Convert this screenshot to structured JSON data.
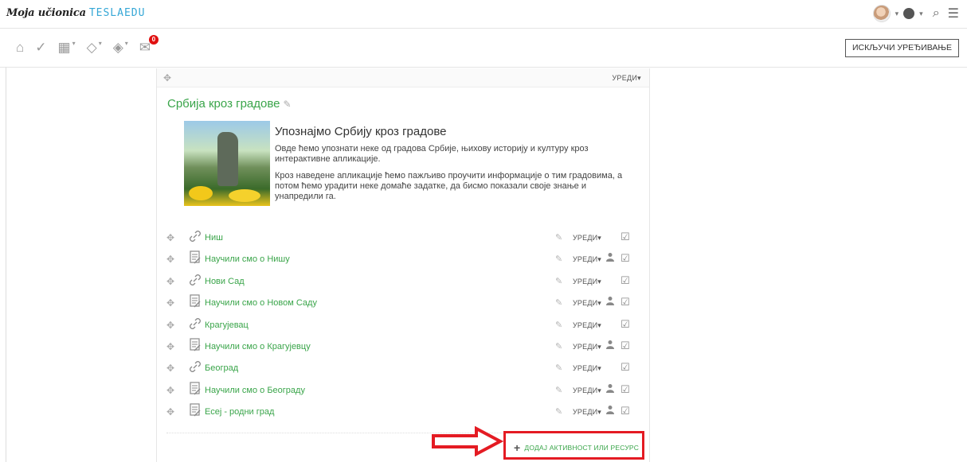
{
  "topbar": {
    "logo_script": "Moja učionica",
    "logo_brand": "TESLAEDU",
    "user_avatar": "avatar",
    "language_icon": "globe-icon",
    "search_icon": "search-icon",
    "menu_icon": "hamburger-icon"
  },
  "navbar": {
    "icons": [
      "home-icon",
      "checkmark-icon",
      "calendar-icon",
      "graduation-cap-icon",
      "graduation-cap-settings-icon",
      "messages-icon"
    ],
    "messages_badge": "0",
    "edit_mode_button": "ИСКЉУЧИ УРЕЂИВАЊЕ"
  },
  "section": {
    "edit_label": "УРЕДИ",
    "title": "Србија кроз градове",
    "summary_heading": "Упознајмо Србију кроз градове",
    "summary_p1": "Овде ћемо упознати неке од градова Србије, њихову историју и културу кроз интерактивне апликације.",
    "summary_p2": "Кроз наведене апликације ћемо пажљиво проучити информације о тим градовима, а потом ћемо урадити неке домаће задатке, да бисмо показали своје знање и унапредили га."
  },
  "activities": [
    {
      "name": "Ниш",
      "type": "url",
      "edit": "УРЕДИ",
      "has_user": false
    },
    {
      "name": "Научили смо о Нишу",
      "type": "assignment",
      "edit": "УРЕДИ",
      "has_user": true
    },
    {
      "name": "Нови Сад",
      "type": "url",
      "edit": "УРЕДИ",
      "has_user": false
    },
    {
      "name": "Научили смо о Новом Саду",
      "type": "assignment",
      "edit": "УРЕДИ",
      "has_user": true
    },
    {
      "name": "Крагујевац",
      "type": "url",
      "edit": "УРЕДИ",
      "has_user": false
    },
    {
      "name": "Научили смо о Крагујевцу",
      "type": "assignment",
      "edit": "УРЕДИ",
      "has_user": true
    },
    {
      "name": "Београд",
      "type": "url",
      "edit": "УРЕДИ",
      "has_user": false
    },
    {
      "name": "Научили смо о Београду",
      "type": "assignment",
      "edit": "УРЕДИ",
      "has_user": true
    },
    {
      "name": "Есеј - родни град",
      "type": "assignment",
      "edit": "УРЕДИ",
      "has_user": true
    }
  ],
  "add_activity": {
    "label": "ДОДАЈ АКТИВНОСТ ИЛИ РЕСУРС",
    "highlight_color": "#e41b23"
  },
  "colors": {
    "link_green": "#3aa54a",
    "annotation_red": "#e41b23"
  }
}
